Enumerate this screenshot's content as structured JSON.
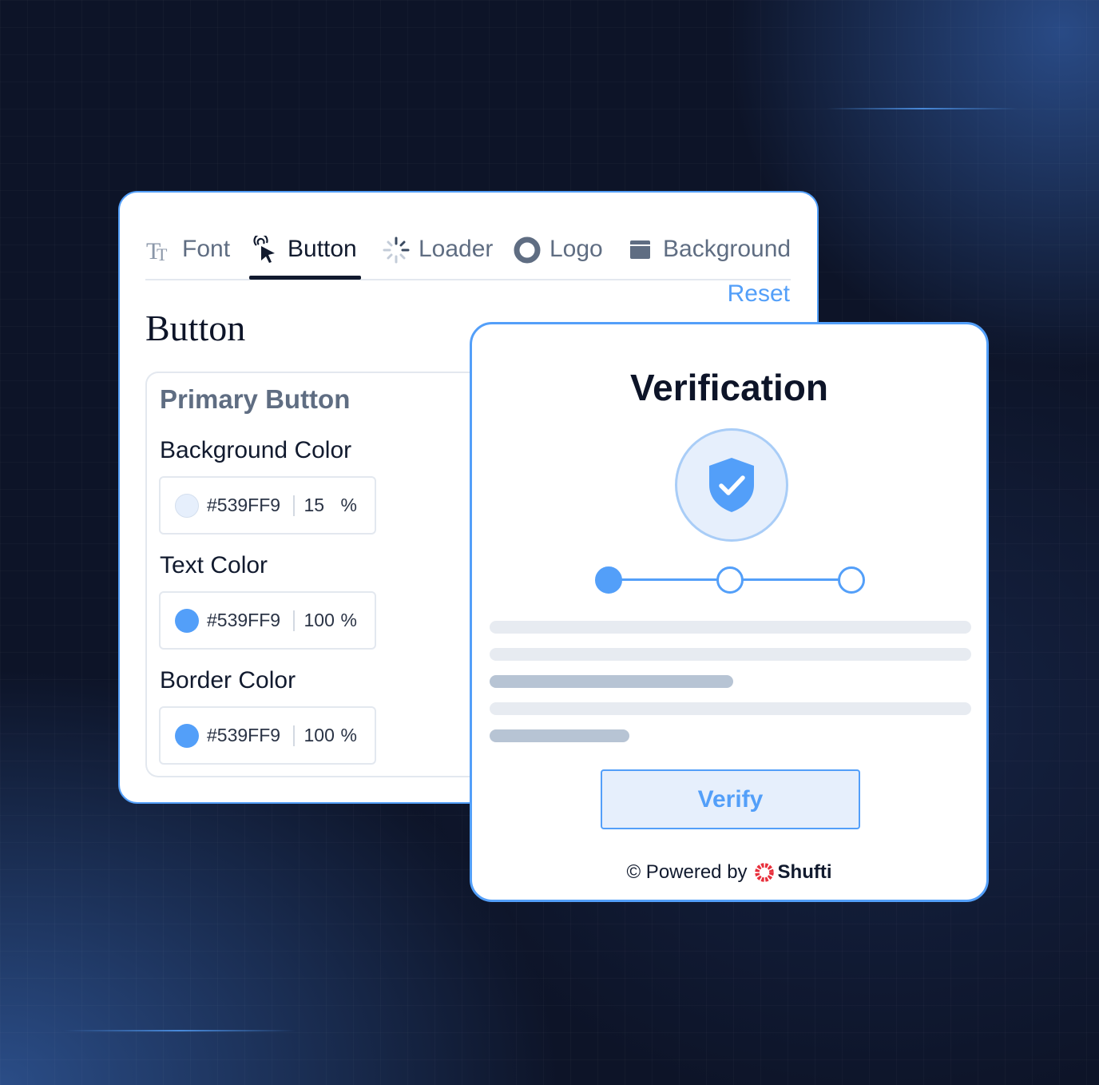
{
  "settings": {
    "tabs": [
      {
        "label": "Font",
        "icon": "font-icon"
      },
      {
        "label": "Button",
        "icon": "pointer-icon"
      },
      {
        "label": "Loader",
        "icon": "loader-icon"
      },
      {
        "label": "Logo",
        "icon": "logo-icon"
      },
      {
        "label": "Background",
        "icon": "background-icon"
      }
    ],
    "active_tab": "Button",
    "reset_label": "Reset",
    "section_title": "Button",
    "primary_button": {
      "title": "Primary Button",
      "fields": [
        {
          "label": "Background Color",
          "hex": "#539FF9",
          "opacity": "15",
          "unit": "%"
        },
        {
          "label": "Text Color",
          "hex": "#539FF9",
          "opacity": "100",
          "unit": "%"
        },
        {
          "label": "Border Color",
          "hex": "#539FF9",
          "opacity": "100",
          "unit": "%"
        }
      ]
    }
  },
  "verification": {
    "title": "Verification",
    "steps_total": 3,
    "current_step": 1,
    "button_label": "Verify",
    "powered_by": "© Powered by",
    "brand": "Shufti"
  },
  "colors": {
    "accent": "#539FF9",
    "accent_light": "#E6EFFC",
    "dark_bg": "#0D1428",
    "text_dark": "#111A2E",
    "text_muted": "#5F6D82",
    "brand_red": "#E8303C"
  }
}
